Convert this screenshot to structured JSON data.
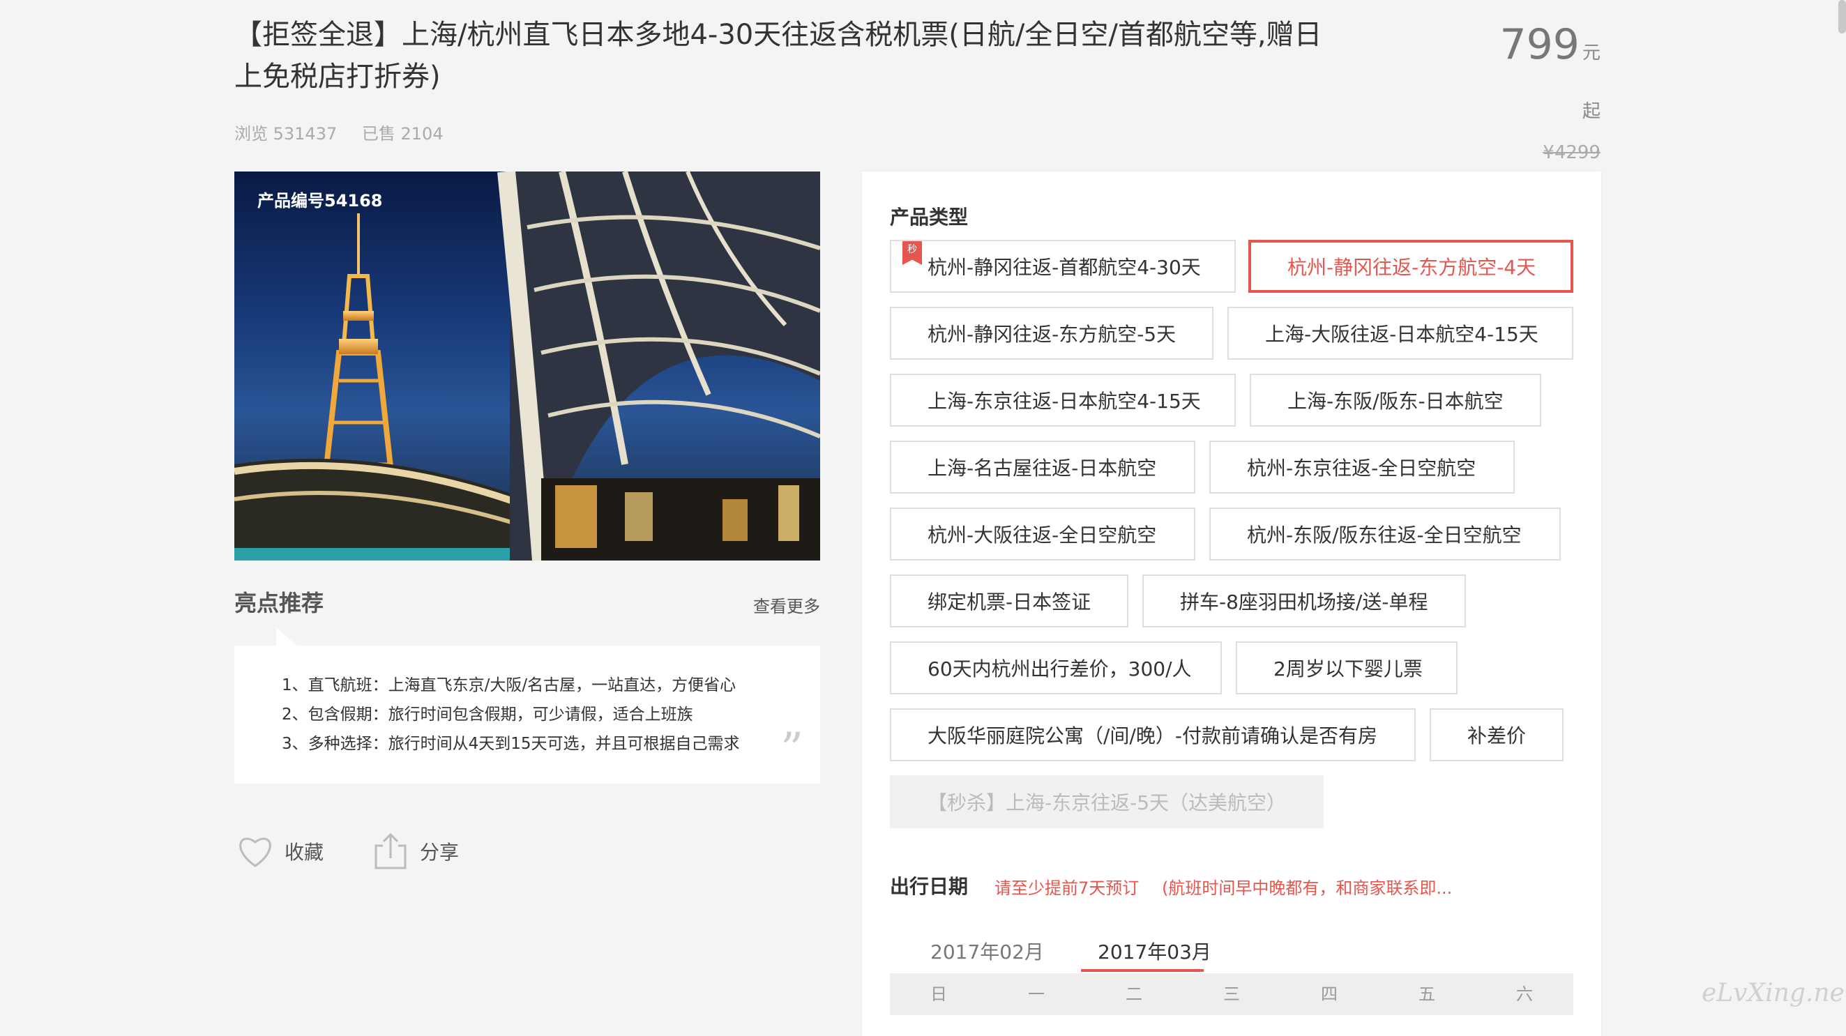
{
  "product": {
    "title": "【拒签全退】上海/杭州直飞日本多地4-30天往返含税机票(日航/全日空/首都航空等,赠日上免税店打折券)",
    "price": "799",
    "price_unit": "元起",
    "original_price": "¥4299",
    "views_label": "浏览 531437",
    "sold_label": "已售 2104",
    "product_code": "产品编号54168"
  },
  "highlights": {
    "title": "亮点推荐",
    "more": "查看更多",
    "items": [
      "1、直飞航班：上海直飞东京/大阪/名古屋，一站直达，方便省心",
      "2、包含假期：旅行时间包含假期，可少请假，适合上班族",
      "3、多种选择：旅行时间从4天到15天可选，并且可根据自己需求"
    ],
    "quote_mark": "”"
  },
  "actions": {
    "favorite": "收藏",
    "share": "分享"
  },
  "product_type": {
    "label": "产品类型",
    "badge": "秒",
    "options": [
      "杭州-静冈往返-首都航空4-30天",
      "杭州-静冈往返-东方航空-4天",
      "杭州-静冈往返-东方航空-5天",
      "上海-大阪往返-日本航空4-15天",
      "上海-东京往返-日本航空4-15天",
      "上海-东阪/阪东-日本航空",
      "上海-名古屋往返-日本航空",
      "杭州-东京往返-全日空航空",
      "杭州-大阪往返-全日空航空",
      "杭州-东阪/阪东往返-全日空航空",
      "绑定机票-日本签证",
      "拼车-8座羽田机场接/送-单程",
      "60天内杭州出行差价，300/人",
      "2周岁以下婴儿票",
      "大阪华丽庭院公寓（/间/晚）-付款前请确认是否有房",
      "补差价",
      "【秒杀】上海-东京往返-5天（达美航空）"
    ]
  },
  "travel_date": {
    "label": "出行日期",
    "notice1": "请至少提前7天预订",
    "notice2": "(航班时间早中晚都有，和商家联系即...",
    "months": [
      "2017年02月",
      "2017年03月"
    ],
    "weekdays": [
      "日",
      "一",
      "二",
      "三",
      "四",
      "五",
      "六"
    ]
  },
  "watermark": "eLvXing.net",
  "colors": {
    "accent": "#e4564e",
    "bg": "#f4f4f4"
  }
}
